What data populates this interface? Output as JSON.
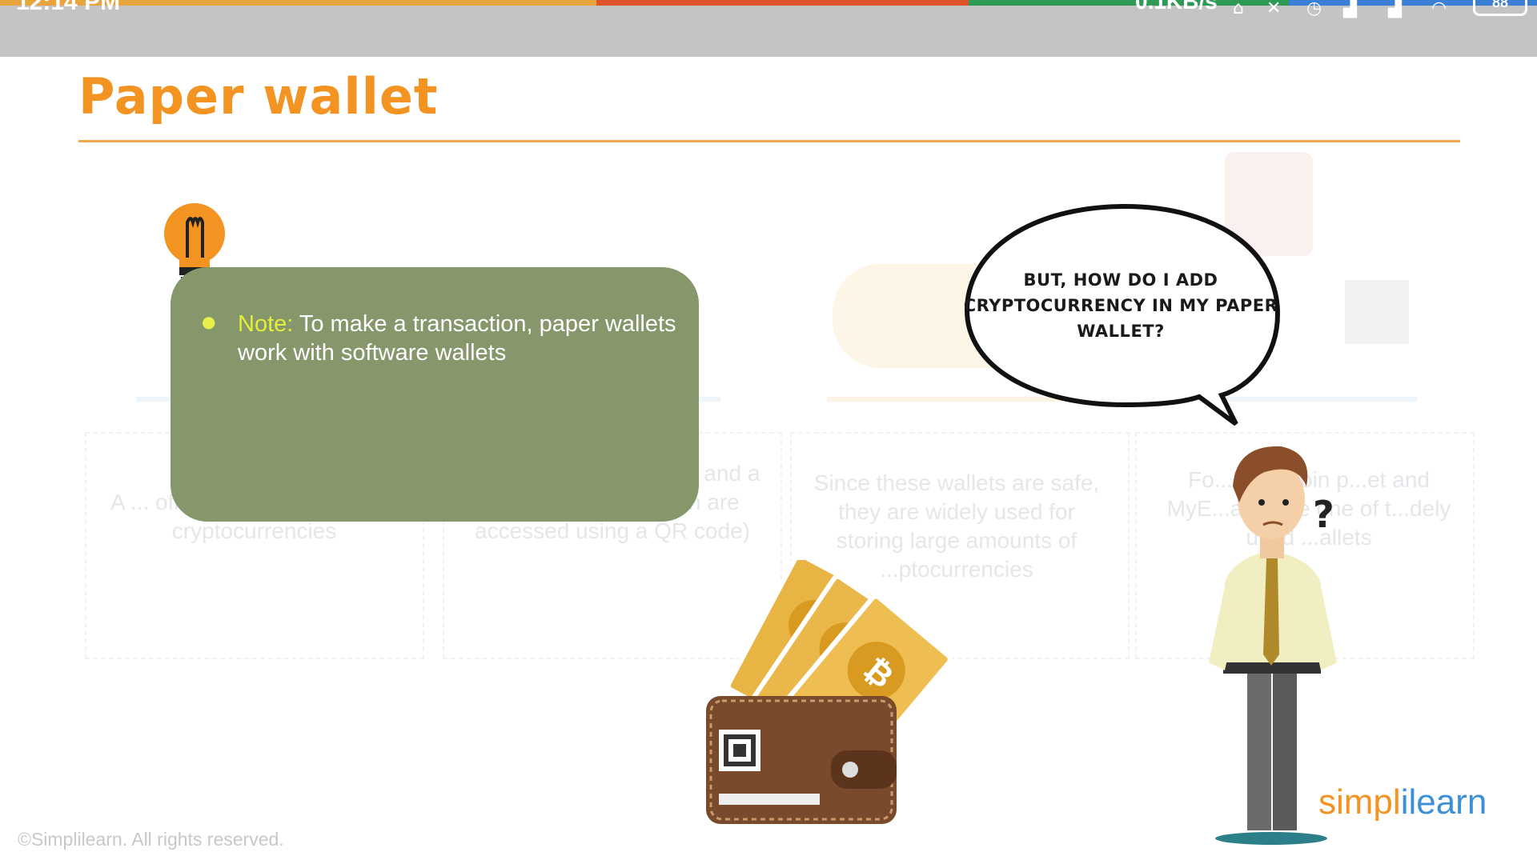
{
  "status_bar": {
    "time": "12:14 PM",
    "net_speed": "0.1KB/s",
    "battery": "88",
    "icons": [
      "usb-icon",
      "mute-icon",
      "alarm-icon",
      "signal-icon",
      "signal-icon",
      "wifi-icon",
      "battery-icon"
    ]
  },
  "slide": {
    "title": "Paper wallet",
    "note": {
      "label": "Note:",
      "text": " To make a transaction, paper wallets work with software wallets"
    },
    "speech_bubble": "BUT, HOW DO I ADD CRYPTOCURRENCY IN MY PAPER WALLET?",
    "question_mark": "?",
    "faded_cards": [
      "A ... offline process of storing cryptocurrencies",
      "...ted ... of a private key and a public address (which are accessed using a QR code)",
      "Since these wallets are safe, they are widely used for storing large amounts of ...ptocurrencies",
      "Fo...le, Bitcoin p...et and MyE...allet are one of t...dely used ...allets"
    ],
    "copyright": "©Simplilearn. All rights reserved.",
    "logo": "simplilearn"
  },
  "colors": {
    "title": "#f39321",
    "note_bg": "#85976b",
    "note_label": "#e5ee3a",
    "logo_blue": "#3d8fd6",
    "logo_orange": "#f39321"
  }
}
